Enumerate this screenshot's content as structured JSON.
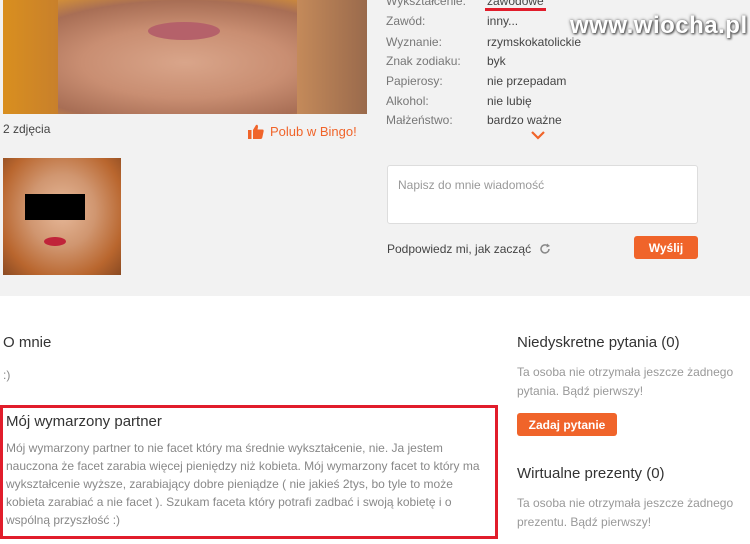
{
  "profile": {
    "photos_count": "2 zdjęcia",
    "like_bingo": "Polub w Bingo!",
    "details": [
      {
        "label": "Wykształcenie:",
        "value": "zawodowe"
      },
      {
        "label": "Zawód:",
        "value": "inny..."
      },
      {
        "label": "Wyznanie:",
        "value": "rzymskokatolickie"
      },
      {
        "label": "Znak zodiaku:",
        "value": "byk"
      },
      {
        "label": "Papierosy:",
        "value": "nie przepadam"
      },
      {
        "label": "Alkohol:",
        "value": "nie lubię"
      },
      {
        "label": "Małżeństwo:",
        "value": "bardzo ważne"
      }
    ]
  },
  "watermark": "www.wiocha.pl",
  "message": {
    "placeholder": "Napisz do mnie wiadomość",
    "hint": "Podpowiedz mi, jak zacząć",
    "send_label": "Wyślij"
  },
  "about": {
    "title": "O mnie",
    "text": ":)"
  },
  "partner": {
    "title": "Mój wymarzony partner",
    "text": "Mój wymarzony partner to nie facet który ma średnie wykształcenie, nie. Ja jestem nauczona że facet zarabia więcej pieniędzy niż kobieta. Mój wymarzony facet to który ma wykształcenie wyższe, zarabiający dobre pieniądze ( nie jakieś 2tys, bo tyle to może kobieta zarabiać a nie facet ). Szukam faceta który potrafi zadbać i swoją kobietę i o wspólną przyszłość :)"
  },
  "questions": {
    "title": "Niedyskretne pytania (0)",
    "text": "Ta osoba nie otrzymała jeszcze żadnego pytania. Bądź pierwszy!",
    "ask_label": "Zadaj pytanie"
  },
  "gifts": {
    "title": "Wirtualne prezenty (0)",
    "text": "Ta osoba nie otrzymała jeszcze żadnego prezentu. Bądź pierwszy!"
  },
  "colors": {
    "accent": "#f0642a",
    "highlight_red": "#e11d2b"
  }
}
